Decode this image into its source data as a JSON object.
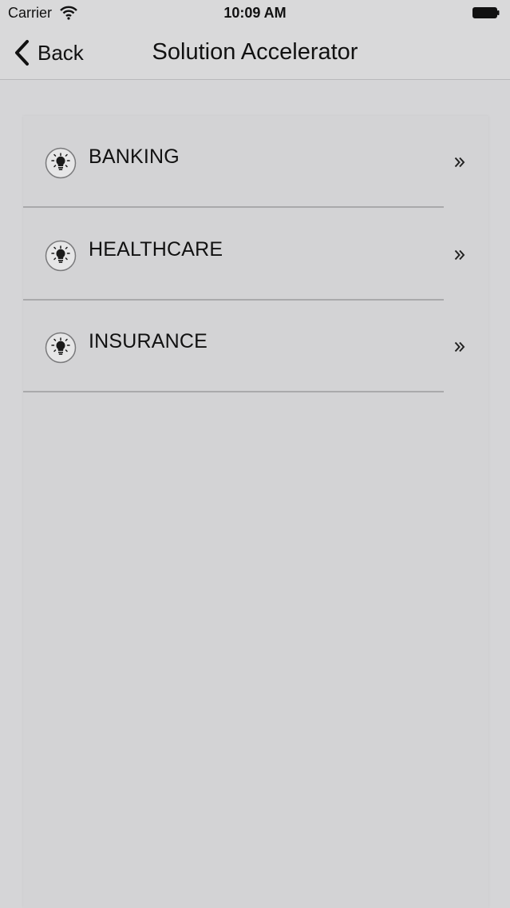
{
  "status_bar": {
    "carrier": "Carrier",
    "time": "10:09 AM",
    "icons": [
      "wifi-icon",
      "battery-icon"
    ]
  },
  "nav": {
    "back_label": "Back",
    "title": "Solution Accelerator",
    "back_icon": "chevron-left-icon"
  },
  "list": {
    "items": [
      {
        "label": "BANKING",
        "icon": "lightbulb-icon",
        "chevron": "double-chevron-right-icon"
      },
      {
        "label": "HEALTHCARE",
        "icon": "lightbulb-icon",
        "chevron": "double-chevron-right-icon"
      },
      {
        "label": "INSURANCE",
        "icon": "lightbulb-icon",
        "chevron": "double-chevron-right-icon"
      }
    ]
  },
  "colors": {
    "background": "#d5d5d7",
    "bar": "#d9d9da",
    "divider": "#a9a9ab",
    "text": "#111111"
  }
}
